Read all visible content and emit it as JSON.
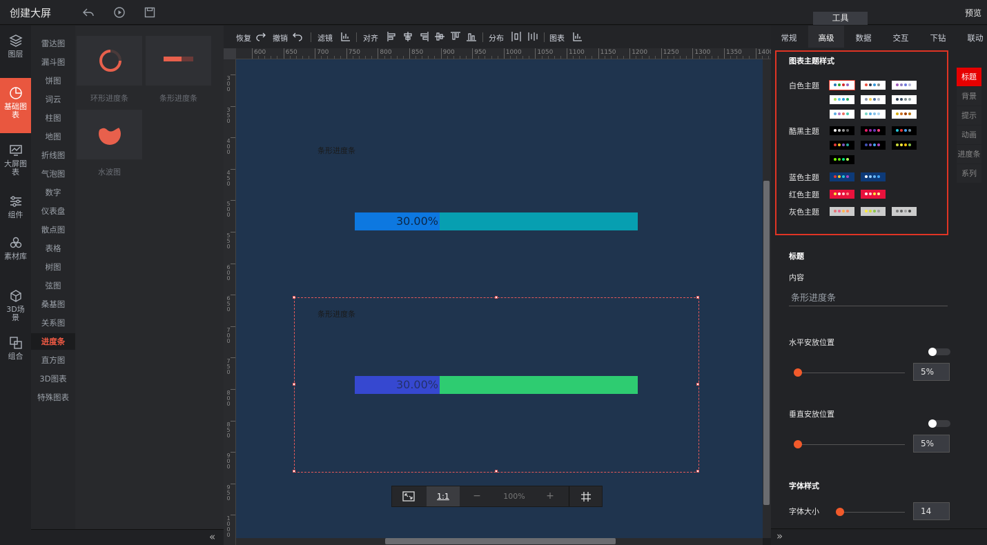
{
  "header": {
    "title": "创建大屏",
    "preview": "预览",
    "tools_tab": "工具"
  },
  "rail": [
    {
      "label": "图层",
      "icon": "layers-icon"
    },
    {
      "label": "基础图表",
      "icon": "pie-chart-icon",
      "active": true
    },
    {
      "label": "大屏图表",
      "icon": "monitor-chart-icon"
    },
    {
      "label": "组件",
      "icon": "sliders-icon"
    },
    {
      "label": "素材库",
      "icon": "hexagons-icon"
    },
    {
      "label": "3D场景",
      "icon": "cube-icon"
    },
    {
      "label": "组合",
      "icon": "combine-icon"
    }
  ],
  "categories": [
    "雷达图",
    "漏斗图",
    "饼图",
    "词云",
    "柱图",
    "地图",
    "折线图",
    "气泡图",
    "数字",
    "仪表盘",
    "散点图",
    "表格",
    "树图",
    "弦图",
    "桑基图",
    "关系图",
    "进度条",
    "直方图",
    "3D图表",
    "特殊图表"
  ],
  "active_category": "进度条",
  "thumbnails": [
    {
      "label": "环形进度条"
    },
    {
      "label": "条形进度条"
    },
    {
      "label": "水波图"
    }
  ],
  "toolbar": {
    "redo": "恢复",
    "undo": "撤销",
    "filter": "滤镜",
    "align": "对齐",
    "distribute": "分布",
    "chart": "图表"
  },
  "ruler_h": [
    "600",
    "650",
    "700",
    "750",
    "800",
    "850",
    "900",
    "950",
    "1000",
    "1050",
    "1100",
    "1150",
    "1200",
    "1250",
    "1300",
    "1350",
    "1400"
  ],
  "ruler_v": [
    "300",
    "350",
    "400",
    "450",
    "500",
    "550",
    "600",
    "650",
    "700",
    "750",
    "800",
    "850",
    "900",
    "950",
    "1000"
  ],
  "widgets": [
    {
      "title": "条形进度条",
      "value_text": "30.00%",
      "percent": 30,
      "fill_color": "#0d78e0",
      "rest_color": "#079fb1",
      "text_color": "#0b2748"
    },
    {
      "title": "条形进度条",
      "value_text": "30.00%",
      "percent": 30,
      "fill_color": "#3648d0",
      "rest_color": "#2ecc71",
      "text_color": "#23316b"
    }
  ],
  "zoom": {
    "fit": "fit-screen-icon",
    "one_to_one": "1:1",
    "minus": "−",
    "level": "100%",
    "plus": "+",
    "grid": "grid-icon"
  },
  "right_tabs": [
    "常规",
    "高级",
    "数据",
    "交互",
    "下钻",
    "联动"
  ],
  "active_right_tab": "高级",
  "theme_panel": {
    "title": "图表主题样式",
    "groups": [
      {
        "name": "白色主题",
        "swatches": [
          {
            "bg": "#ffffff",
            "dots": [
              "#1f77b4",
              "#2ca02c",
              "#d62728",
              "#9467bd"
            ],
            "selected": true
          },
          {
            "bg": "#ffffff",
            "dots": [
              "#e74c3c",
              "#2c3e50",
              "#3498db",
              "#7f8c8d"
            ]
          },
          {
            "bg": "#ffffff",
            "dots": [
              "#9b59b6",
              "#8e7cc3",
              "#6c7ae0",
              "#b8b8d8"
            ]
          },
          {
            "bg": "#ffffff",
            "dots": [
              "#a8e063",
              "#56ccf2",
              "#2d9cdb",
              "#27ae60"
            ]
          },
          {
            "bg": "#ffffff",
            "dots": [
              "#8e9aaf",
              "#f2c94c",
              "#4a6fa5",
              "#b0b7c3"
            ]
          },
          {
            "bg": "#ffffff",
            "dots": [
              "#2c3e50",
              "#34495e",
              "#7f8c8d",
              "#95a5a6"
            ]
          },
          {
            "bg": "#ffffff",
            "dots": [
              "#5dade2",
              "#af7ac5",
              "#ec7063",
              "#48c9b0"
            ]
          },
          {
            "bg": "#ffffff",
            "dots": [
              "#76d7c4",
              "#5dade2",
              "#85c1e9",
              "#aed6f1"
            ]
          },
          {
            "bg": "#ffffff",
            "dots": [
              "#d4ac0d",
              "#ca6f1e",
              "#a04000",
              "#b9770e"
            ]
          }
        ]
      },
      {
        "name": "酷黑主题",
        "swatches": [
          {
            "bg": "#000000",
            "dots": [
              "#ffffff",
              "#cccccc",
              "#999999",
              "#666666"
            ]
          },
          {
            "bg": "#000000",
            "dots": [
              "#e91e63",
              "#9c27b0",
              "#673ab7",
              "#ff4081"
            ]
          },
          {
            "bg": "#000000",
            "dots": [
              "#26c6da",
              "#e53935",
              "#42a5f5",
              "#78909c"
            ]
          },
          {
            "bg": "#000000",
            "dots": [
              "#e53935",
              "#fbc02d",
              "#7e57c2",
              "#26a69a"
            ]
          },
          {
            "bg": "#000000",
            "dots": [
              "#3f51b5",
              "#7e57c2",
              "#42a5f5",
              "#ab47bc"
            ]
          },
          {
            "bg": "#000000",
            "dots": [
              "#cddc39",
              "#ffeb3b",
              "#ffc107",
              "#8bc34a"
            ]
          },
          {
            "bg": "#000000",
            "dots": [
              "#76ff03",
              "#64dd17",
              "#00e676",
              "#b2ff59"
            ]
          }
        ]
      },
      {
        "name": "蓝色主题",
        "swatches": [
          {
            "bg": "#0d3a78",
            "dots": [
              "#e53935",
              "#ffca28",
              "#26c6da",
              "#ab47bc"
            ]
          },
          {
            "bg": "#0d3a78",
            "dots": [
              "#ffffff",
              "#90caf9",
              "#64b5f6",
              "#42a5f5"
            ]
          }
        ]
      },
      {
        "name": "红色主题",
        "swatches": [
          {
            "bg": "#e8123c",
            "dots": [
              "#ffeb3b",
              "#ffffff",
              "#ffcdd2",
              "#ff8a80"
            ]
          },
          {
            "bg": "#e8123c",
            "dots": [
              "#ffffff",
              "#ffcdd2",
              "#ffeb3b",
              "#fff59d"
            ]
          }
        ]
      },
      {
        "name": "灰色主题",
        "swatches": [
          {
            "bg": "#cccccc",
            "dots": [
              "#e57373",
              "#f06292",
              "#ffb74d",
              "#ff8a65"
            ]
          },
          {
            "bg": "#cccccc",
            "dots": [
              "#ffeb3b",
              "#cddc39",
              "#8bc34a",
              "#9e9e9e"
            ]
          },
          {
            "bg": "#cccccc",
            "dots": [
              "#757575",
              "#616161",
              "#9e9e9e",
              "#424242"
            ]
          }
        ]
      }
    ]
  },
  "side_tabs": [
    "标题",
    "背景",
    "提示",
    "动画",
    "进度条",
    "系列"
  ],
  "title_section": {
    "heading": "标题",
    "content_label": "内容",
    "content_value": "条形进度条",
    "h_pos_label": "水平安放位置",
    "h_pos_value": "5%",
    "v_pos_label": "垂直安放位置",
    "v_pos_value": "5%",
    "font_heading": "字体样式",
    "font_size_label": "字体大小",
    "font_size_value": "14"
  }
}
